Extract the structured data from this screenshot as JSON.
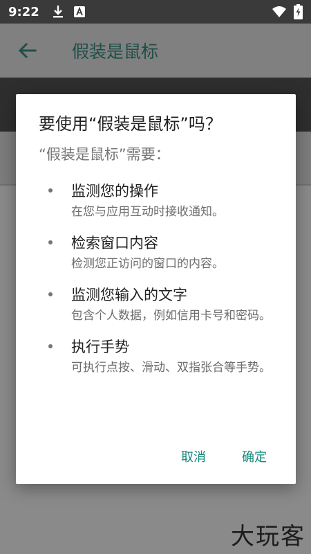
{
  "status_bar": {
    "time": "9:22",
    "left_icons": [
      "download-icon",
      "accessibility-a-icon"
    ],
    "right_icons": [
      "wifi-icon",
      "battery-charging-icon"
    ]
  },
  "app_bar": {
    "title": "假装是鼠标",
    "back_icon": "back-arrow-icon"
  },
  "dialog": {
    "title": "要使用“假装是鼠标”吗？",
    "subtitle": "“假装是鼠标”需要：",
    "permissions": [
      {
        "title": "监测您的操作",
        "desc": "在您与应用互动时接收通知。"
      },
      {
        "title": "检索窗口内容",
        "desc": "检测您正访问的窗口的内容。"
      },
      {
        "title": "监测您输入的文字",
        "desc": "包含个人数据，例如信用卡号和密码。"
      },
      {
        "title": "执行手势",
        "desc": "可执行点按、滑动、双指张合等手势。"
      }
    ],
    "cancel_label": "取消",
    "confirm_label": "确定"
  },
  "watermark": "大玩客",
  "colors": {
    "accent": "#11897a",
    "dialog_bg": "#ffffff",
    "scrim": "#8a8a8a"
  }
}
